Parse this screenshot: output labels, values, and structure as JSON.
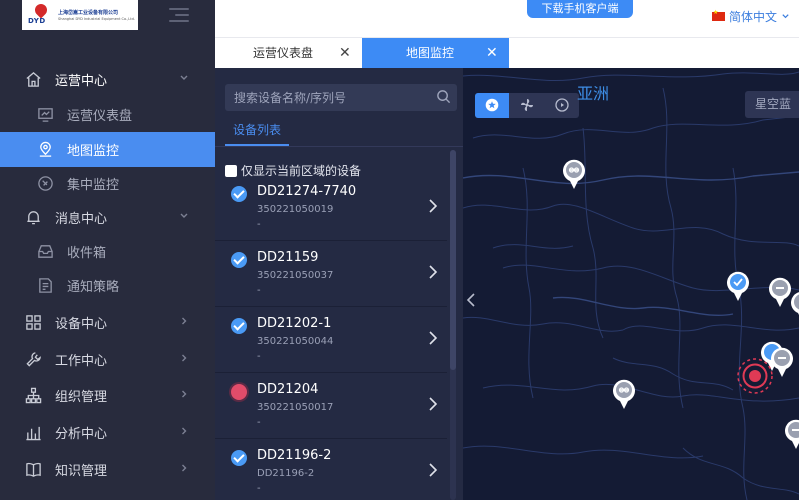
{
  "logo": {
    "mark": "DYD",
    "line1": "上海岱嵩工业设备有限公司",
    "line2": "Shanghai DYD Industrial Equipment Co.,Ltd."
  },
  "sidebar": {
    "items": [
      {
        "label": "运营中心",
        "icon": "home-icon",
        "level": 1,
        "expanded": true
      },
      {
        "label": "运营仪表盘",
        "icon": "dashboard-icon",
        "level": 2
      },
      {
        "label": "地图监控",
        "icon": "map-pin-icon",
        "level": 2,
        "active": true
      },
      {
        "label": "集中监控",
        "icon": "compass-icon",
        "level": 2
      },
      {
        "label": "消息中心",
        "icon": "bell-icon",
        "level": 1,
        "expanded": true
      },
      {
        "label": "收件箱",
        "icon": "inbox-icon",
        "level": 2
      },
      {
        "label": "通知策略",
        "icon": "notice-policy-icon",
        "level": 2
      },
      {
        "label": "设备中心",
        "icon": "grid-icon",
        "level": 1
      },
      {
        "label": "工作中心",
        "icon": "wrench-icon",
        "level": 1
      },
      {
        "label": "组织管理",
        "icon": "org-chart-icon",
        "level": 1
      },
      {
        "label": "分析中心",
        "icon": "bar-chart-icon",
        "level": 1
      },
      {
        "label": "知识管理",
        "icon": "book-icon",
        "level": 1
      }
    ]
  },
  "header": {
    "download_label": "下载手机客户端",
    "language": "简体中文"
  },
  "tabs": [
    {
      "label": "运营仪表盘",
      "active": false
    },
    {
      "label": "地图监控",
      "active": true
    }
  ],
  "device_panel": {
    "search_placeholder": "搜索设备名称/序列号",
    "list_tab": "设备列表",
    "only_area_label": "仅显示当前区域的设备",
    "devices": [
      {
        "name": "DD21274-7740",
        "serial": "350221050019",
        "extra": "-",
        "status": "ok"
      },
      {
        "name": "DD21159",
        "serial": "350221050037",
        "extra": "-",
        "status": "ok"
      },
      {
        "name": "DD21202-1",
        "serial": "350221050044",
        "extra": "-",
        "status": "ok"
      },
      {
        "name": "DD21204",
        "serial": "350221050017",
        "extra": "-",
        "status": "alarm"
      },
      {
        "name": "DD21196-2",
        "serial": "DD21196-2",
        "extra": "-",
        "status": "ok"
      }
    ]
  },
  "map": {
    "region_label": "亚洲",
    "style_label": "星空蓝",
    "controls": [
      "star-icon",
      "fan-icon",
      "signal-icon"
    ],
    "colors": {
      "background": "#141b34",
      "border": "#2a3a6a",
      "ok": "#4a9af5",
      "offline": "#9aa0b0",
      "alarm": "#e03a55"
    }
  }
}
